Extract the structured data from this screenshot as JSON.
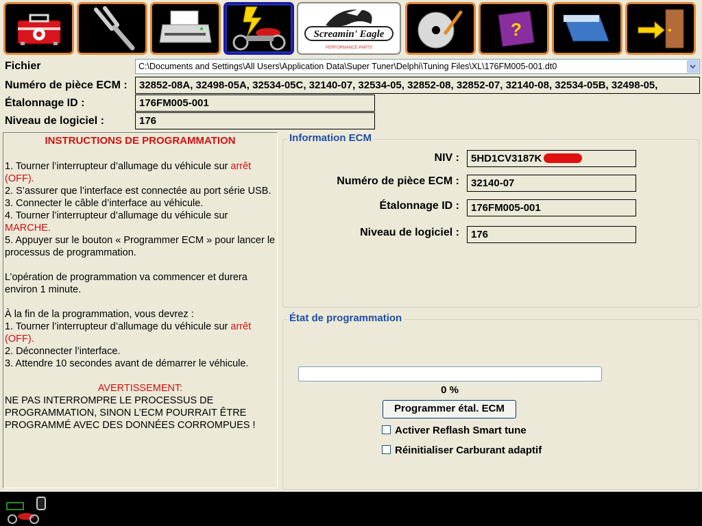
{
  "toolbar": {
    "buttons": [
      {
        "icon": "toolbox-icon"
      },
      {
        "icon": "tuning-fork-icon"
      },
      {
        "icon": "printer-icon"
      },
      {
        "icon": "motorcycle-lightning-icon",
        "active": true
      },
      {
        "icon": "screamin-eagle-logo",
        "logo_text": "Screamin' Eagle",
        "logo_sub": "PERFORMANCE PARTS"
      },
      {
        "icon": "cd-write-icon"
      },
      {
        "icon": "help-book-icon"
      },
      {
        "icon": "window-icon"
      },
      {
        "icon": "exit-door-icon"
      }
    ]
  },
  "header": {
    "file_label": "Fichier",
    "file_path": "C:\\Documents and Settings\\All Users\\Application Data\\Super Tuner\\Delphi\\Tuning Files\\XL\\176FM005-001.dt0",
    "ecm_part_label": "Numéro de pièce ECM :",
    "ecm_part_value": "32852-08A, 32498-05A, 32534-05C, 32140-07, 32534-05, 32852-08, 32852-07, 32140-08, 32534-05B, 32498-05,",
    "calibration_label": "Étalonnage ID :",
    "calibration_value": "176FM005-001",
    "software_label": "Niveau de logiciel :",
    "software_value": "176"
  },
  "instructions": {
    "title": "INSTRUCTIONS DE PROGRAMMATION",
    "step1_a": "1. Tourner l’interrupteur d’allumage du véhicule sur ",
    "step1_b": "arrêt (OFF).",
    "step2": "2. S’assurer que l’interface est connectée au port série USB.",
    "step3": "3. Connecter le câble d’interface au véhicule.",
    "step4_a": "4. Tourner l’interrupteur d’allumage du véhicule sur ",
    "step4_b": "MARCHE.",
    "step5": "5. Appuyer sur le bouton « Programmer ECM » pour lancer le processus de programmation.",
    "duration": "L’opération de programmation va commencer et durera environ 1 minute.",
    "after_title": "À la fin de la programmation, vous devrez :",
    "after1_a": "1. Tourner l’interrupteur d’allumage du véhicule sur ",
    "after1_b": "arrêt (OFF).",
    "after2": "2. Déconnecter l’interface.",
    "after3": "3. Attendre 10 secondes avant de démarrer le véhicule.",
    "warning_title": "AVERTISSEMENT:",
    "warning_text": "NE PAS INTERROMPRE LE PROCESSUS DE PROGRAMMATION, SINON L’ECM POURRAIT ÊTRE PROGRAMMÉ AVEC DES DONNÉES CORROMPUES !"
  },
  "ecm_info": {
    "title": "Information ECM",
    "vin_label": "NIV :",
    "vin_value": "5HD1CV3187K",
    "part_label": "Numéro de pièce ECM :",
    "part_value": "32140-07",
    "calibration_label": "Étalonnage ID :",
    "calibration_value": "176FM005-001",
    "software_label": "Niveau de logiciel :",
    "software_value": "176"
  },
  "programming": {
    "title": "État de programmation",
    "progress": 0,
    "progress_text": "0 %",
    "button_label": "Programmer étal. ECM",
    "checkbox1_label": "Activer Reflash Smart tune",
    "checkbox1_checked": false,
    "checkbox2_label": "Réinitialiser Carburant adaptif",
    "checkbox2_checked": false
  },
  "status_bar": {
    "icon": "motorcycle-connection-icon"
  },
  "colors": {
    "accent_orange": "#e0893a",
    "warning_red": "#d01010",
    "group_title_blue": "#1f4fa5",
    "background": "#ece9d8"
  }
}
